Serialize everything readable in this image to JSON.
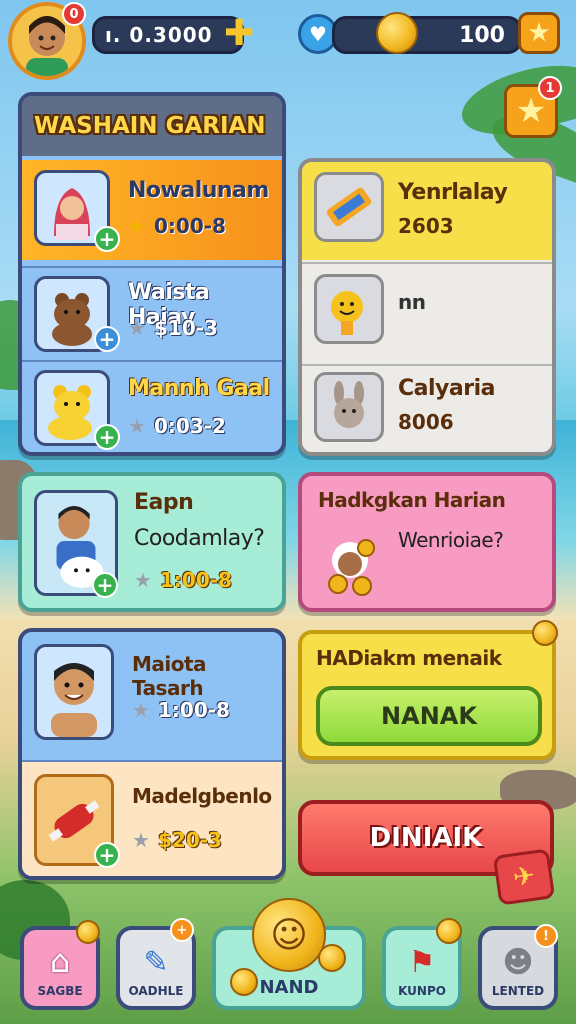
{
  "top_bar": {
    "player_avatar": "player-avatar",
    "avatar_badge": "0",
    "currency_value": "ı. 0.3000",
    "coins_value": "100"
  },
  "left_panel": {
    "title": "WASHAIN GARIAN",
    "rows": [
      {
        "name": "Nowalunam",
        "value": "0:00-8",
        "icon": "girl-portrait"
      },
      {
        "name": "Waista Haiay",
        "value": "$10-3",
        "icon": "bear-toy"
      },
      {
        "name": "Mannh Gaal",
        "value": "0:03-2",
        "icon": "yellow-bear"
      }
    ]
  },
  "right_panel": {
    "rows": [
      {
        "name": "Yenrlalay",
        "value": "2603",
        "icon": "ticket"
      },
      {
        "name": "nn",
        "value": "",
        "icon": "smiley-toy"
      },
      {
        "name": "Calyaria",
        "value": "8006",
        "icon": "bunny"
      }
    ]
  },
  "mid_left": {
    "title": "Eapn",
    "subtitle": "Coodamlay?",
    "value": "1:00-8"
  },
  "mid_right": {
    "title": "Hadkgkan Harian",
    "subtitle": "Wenrioiae?"
  },
  "lower_left": [
    {
      "name": "Maiota Tasarh",
      "value": "1:00-8",
      "icon": "boy-portrait"
    },
    {
      "name": "Madelgbenlo",
      "value": "$20-3",
      "icon": "candy-item"
    }
  ],
  "lower_right": {
    "title": "HADiakm menaik",
    "green_button": "NANAK",
    "red_button": "DINIAIK"
  },
  "bottom_nav": [
    {
      "label": "SAGBE",
      "icon": "home-icon"
    },
    {
      "label": "OADHLE",
      "icon": "pencil-icon"
    },
    {
      "label": "NAND",
      "icon": "smiley-coin-icon"
    },
    {
      "label": "KUNPO",
      "icon": "plunger-icon"
    },
    {
      "label": "LENTED",
      "icon": "person-icon"
    }
  ],
  "colors": {
    "accent_orange": "#f7a21b",
    "accent_blue": "#8ec2f5",
    "pink": "#f79bc3",
    "green_btn": "#8fd93a",
    "red_btn": "#e8474a"
  }
}
